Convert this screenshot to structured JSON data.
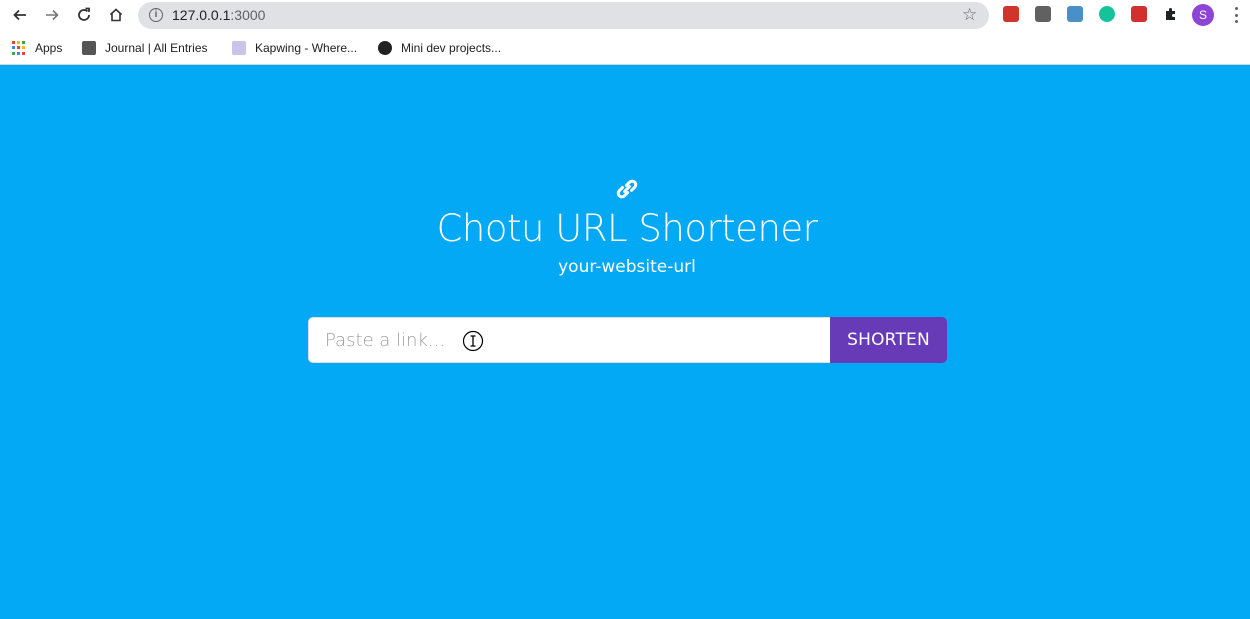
{
  "browser": {
    "url_host": "127.0.0.1",
    "url_port": ":3000",
    "profile_initial": "S",
    "icons": [
      "back-icon",
      "forward-icon",
      "reload-icon",
      "home-icon",
      "info-icon",
      "star-icon",
      "extensions-icon",
      "menu-icon"
    ]
  },
  "bookmarks": [
    {
      "label": "Apps",
      "icon": "apps-grid-icon"
    },
    {
      "label": "Journal | All Entries",
      "icon": "journal-icon"
    },
    {
      "label": "Kapwing - Where...",
      "icon": "kapwing-icon"
    },
    {
      "label": "Mini dev projects...",
      "icon": "mini-dev-icon"
    }
  ],
  "page": {
    "logo_icon": "link-icon",
    "title": "Chotu URL Shortener",
    "subtitle": "your-website-url",
    "input_placeholder": "Paste a link...",
    "button_label": "SHORTEN"
  },
  "colors": {
    "background": "#03a9f4",
    "button": "#673ab7",
    "text": "#ffffff",
    "profile": "#8e44d4"
  }
}
